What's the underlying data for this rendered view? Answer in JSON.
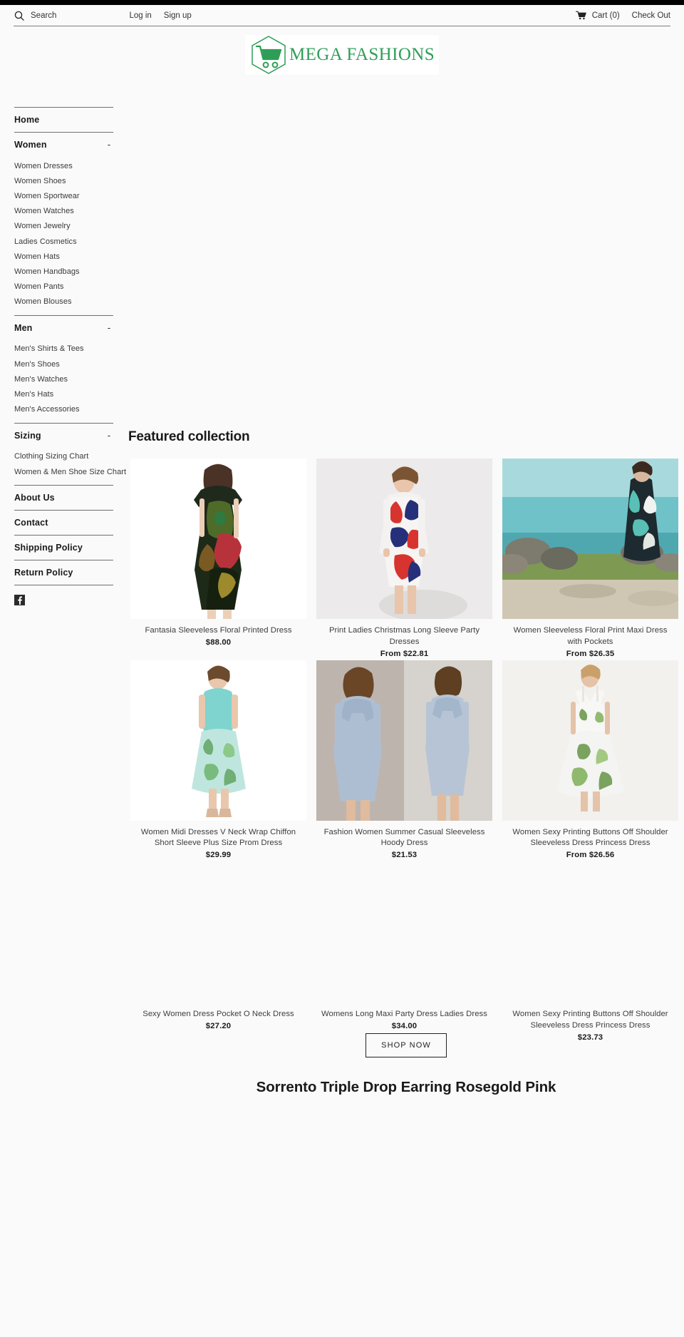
{
  "header": {
    "search": {
      "icon": "search-icon",
      "label": "Search"
    },
    "auth": [
      {
        "label": "Log in"
      },
      {
        "label": "Sign up"
      }
    ],
    "cart": {
      "icon": "shopping-cart-icon",
      "label": "Cart (0)"
    },
    "checkout": {
      "label": "Check Out"
    }
  },
  "logo": {
    "text": "MEGA FASHIONS",
    "icon": "shopping-cart-logo-icon",
    "color": "#2e9e57"
  },
  "sidebar": {
    "sections": [
      {
        "type": "link",
        "label": "Home",
        "name": "sidebar-item-home"
      },
      {
        "type": "group",
        "label": "Women",
        "toggle": "-",
        "name": "sidebar-group-women",
        "items": [
          "Women Dresses",
          "Women Shoes",
          "Women Sportwear",
          "Women Watches",
          "Women Jewelry",
          "Ladies Cosmetics",
          "Women Hats",
          "Women Handbags",
          "Women Pants",
          "Women Blouses"
        ]
      },
      {
        "type": "group",
        "label": "Men",
        "toggle": "-",
        "name": "sidebar-group-men",
        "items": [
          "Men's Shirts & Tees",
          "Men's Shoes",
          "Men's Watches",
          "Men's Hats",
          "Men's Accessories"
        ]
      },
      {
        "type": "group",
        "label": "Sizing",
        "toggle": "-",
        "name": "sidebar-group-sizing",
        "items": [
          "Clothing Sizing Chart",
          "Women & Men Shoe Size Chart"
        ]
      },
      {
        "type": "link",
        "label": "About Us",
        "name": "sidebar-item-about-us"
      },
      {
        "type": "link",
        "label": "Contact",
        "name": "sidebar-item-contact"
      },
      {
        "type": "link",
        "label": "Shipping Policy",
        "name": "sidebar-item-shipping-policy"
      },
      {
        "type": "link",
        "label": "Return Policy",
        "name": "sidebar-item-return-policy"
      }
    ],
    "social": [
      {
        "icon": "facebook-icon",
        "name": "social-link-facebook"
      }
    ]
  },
  "main": {
    "featured_title": "Featured collection",
    "products": [
      {
        "title": "Fantasia Sleeveless Floral Printed Dress",
        "price": "$88.00",
        "image": "dress-floral-green-black"
      },
      {
        "title": "Print Ladies Christmas Long Sleeve Party Dresses",
        "price": "From  $22.81",
        "image": "dress-print-red-blue"
      },
      {
        "title": "Women Sleeveless Floral Print Maxi Dress with Pockets",
        "price": "From  $26.35",
        "image": "dress-maxi-beach"
      },
      {
        "title": "Women Midi Dresses V Neck Wrap Chiffon Short Sleeve Plus Size Prom Dress",
        "price": "$29.99",
        "image": "dress-midi-teal"
      },
      {
        "title": "Fashion Women Summer Casual Sleeveless Hoody Dress",
        "price": "$21.53",
        "image": "dress-hoody-grey"
      },
      {
        "title": "Women Sexy Printing Buttons Off Shoulder Sleeveless Dress Princess Dress",
        "price": "From  $26.56",
        "image": "dress-princess-floral"
      },
      {
        "title": "Sexy Women Dress Pocket O Neck Dress",
        "price": "$27.20",
        "image": ""
      },
      {
        "title": "Womens Long Maxi Party Dress Ladies Dress",
        "price": "$34.00",
        "image": ""
      },
      {
        "title": "Women Sexy Printing Buttons Off Shoulder Sleeveless Dress Princess Dress",
        "price": "$23.73",
        "image": ""
      }
    ],
    "shop_now": "SHOP NOW",
    "bottom_heading": "Sorrento Triple Drop\nEarring Rosegold Pink"
  }
}
